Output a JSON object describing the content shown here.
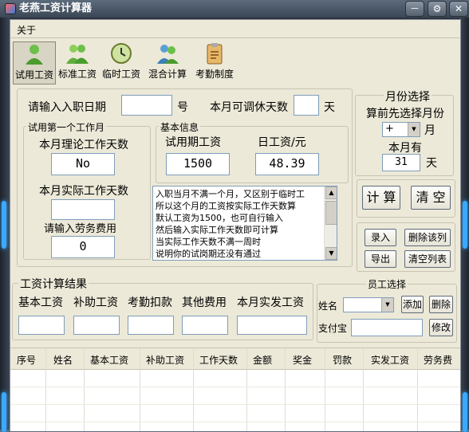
{
  "window": {
    "title": "老燕工资计算器",
    "min_label": "－",
    "settings_label": "⚙",
    "close_label": "✕"
  },
  "menu": {
    "about": "关于"
  },
  "toolbar": {
    "items": [
      {
        "label": "试用工资",
        "icon": "person-icon"
      },
      {
        "label": "标准工资",
        "icon": "group-icon"
      },
      {
        "label": "临时工资",
        "icon": "clock-icon"
      },
      {
        "label": "混合计算",
        "icon": "users-icon"
      },
      {
        "label": "考勤制度",
        "icon": "clipboard-icon"
      }
    ]
  },
  "entry": {
    "hire_date_label": "请输入入职日期",
    "hire_date_value": "",
    "hire_date_unit": "号",
    "rest_days_label": "本月可调休天数",
    "rest_days_value": "",
    "rest_days_unit": "天"
  },
  "first_month": {
    "legend": "试用第一个工作月",
    "theory_days_label": "本月理论工作天数",
    "theory_days_value": "No",
    "actual_days_label": "本月实际工作天数",
    "actual_days_value": "",
    "labor_fee_label": "请输入劳务费用",
    "labor_fee_value": "0"
  },
  "basic_info": {
    "legend": "基本信息",
    "probation_wage_label": "试用期工资",
    "probation_wage_value": "1500",
    "daily_wage_label": "日工资/元",
    "daily_wage_value": "48.39",
    "notes": "入职当月不满一个月，又区别于临时工\n所以这个月的工资按实际工作天数算\n默认工资为1500，也可自行输入\n然后输入实际工作天数即可计算\n当实际工作天数不满一周时\n说明你的试岗期还没有通过"
  },
  "month_select": {
    "legend": "月份选择",
    "hint": "算前先选择月份",
    "month_value": "+",
    "month_unit": "月",
    "month_has_label": "本月有",
    "days_value": "31",
    "days_unit": "天"
  },
  "actions": {
    "calc": "计 算",
    "clear": "清 空"
  },
  "list_actions": {
    "enter": "录入",
    "delete_col": "删除该列",
    "export": "导出",
    "clear_list": "清空列表"
  },
  "result": {
    "legend": "工资计算结果",
    "headers": [
      "基本工资",
      "补助工资",
      "考勤扣款",
      "其他费用",
      "本月实发工资"
    ],
    "values": [
      "",
      "",
      "",
      "",
      ""
    ]
  },
  "employee": {
    "legend": "员工选择",
    "name_label": "姓名",
    "name_value": "",
    "add": "添加",
    "delete": "删除",
    "alipay_label": "支付宝",
    "alipay_value": "",
    "modify": "修改"
  },
  "table": {
    "columns": [
      "序号",
      "姓名",
      "基本工资",
      "补助工资",
      "工作天数",
      "金额",
      "奖金",
      "罚款",
      "实发工资",
      "劳务费"
    ]
  }
}
